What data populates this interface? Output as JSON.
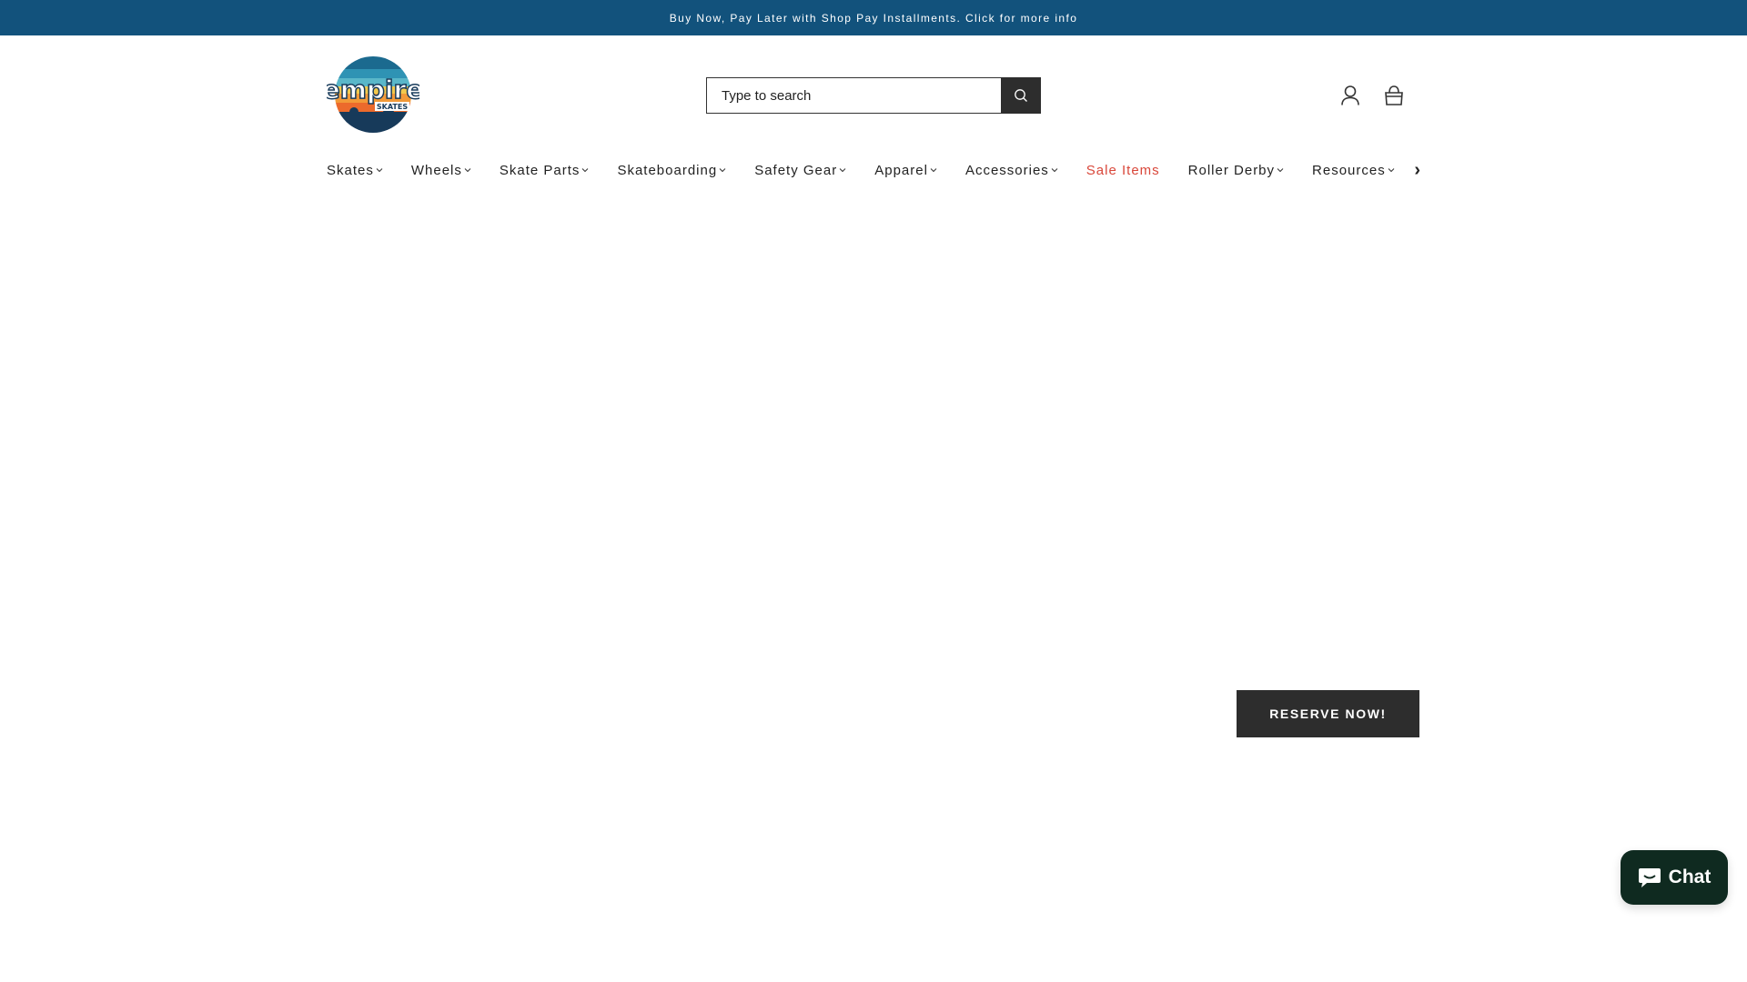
{
  "announcement": {
    "text": "Buy Now, Pay Later with Shop Pay Installments. Click for more info"
  },
  "brand": {
    "logo_text": "empire",
    "logo_subtext": "SKATES"
  },
  "search": {
    "placeholder": "Type to search",
    "button_icon": "search-icon"
  },
  "header_icons": {
    "account_icon": "user-icon",
    "cart_icon": "shopping-bag-icon"
  },
  "nav": {
    "items": [
      {
        "label": "Skates",
        "dropdown": true
      },
      {
        "label": "Wheels",
        "dropdown": true
      },
      {
        "label": "Skate Parts",
        "dropdown": true
      },
      {
        "label": "Skateboarding",
        "dropdown": true
      },
      {
        "label": "Safety Gear",
        "dropdown": true
      },
      {
        "label": "Apparel",
        "dropdown": true
      },
      {
        "label": "Accessories",
        "dropdown": true
      },
      {
        "label": "Sale Items",
        "dropdown": false
      },
      {
        "label": "Roller Derby",
        "dropdown": true
      },
      {
        "label": "Resources",
        "dropdown": true
      }
    ],
    "more": "›"
  },
  "hero": {
    "cta_label": "RESERVE NOW!"
  },
  "chat": {
    "label": "Chat",
    "icon": "chat-bubble-icon"
  },
  "colors": {
    "announcement_bg": "#12527c",
    "sale_red": "#d9473a",
    "button_dark": "#2d2d2d",
    "chat_bg": "#0f2a20"
  }
}
